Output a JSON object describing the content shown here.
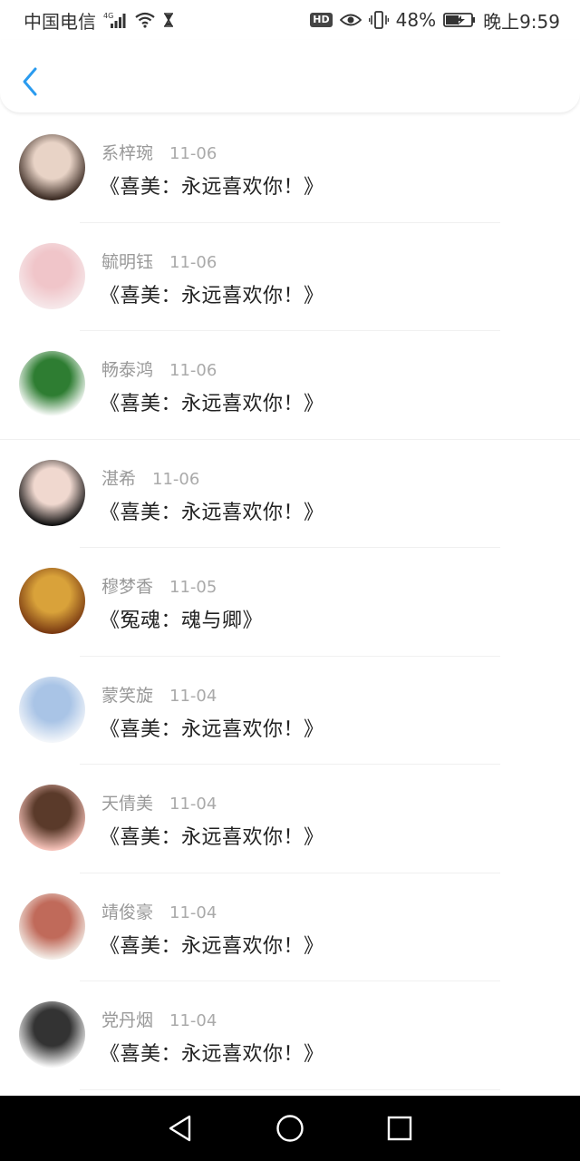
{
  "status_bar": {
    "carrier": "中国电信",
    "network": "4G",
    "hd": "HD",
    "battery": "48%",
    "time": "晚上9:59"
  },
  "accent_color": "#2a9bef",
  "items": [
    {
      "name": "系梓琬",
      "date": "11-06",
      "title": "《喜美：永远喜欢你！》",
      "avatar_colors": [
        "#3a2a22",
        "#e8d3c6"
      ]
    },
    {
      "name": "毓明钰",
      "date": "11-06",
      "title": "《喜美：永远喜欢你！》",
      "avatar_colors": [
        "#f6e8ea",
        "#f0c5c9"
      ]
    },
    {
      "name": "畅泰鸿",
      "date": "11-06",
      "title": "《喜美：永远喜欢你！》",
      "avatar_colors": [
        "#ffffff",
        "#2e7d32"
      ]
    },
    {
      "name": "湛希",
      "date": "11-06",
      "title": "《喜美：永远喜欢你！》",
      "avatar_colors": [
        "#111111",
        "#f0d8cf"
      ]
    },
    {
      "name": "穆梦香",
      "date": "11-05",
      "title": "《冤魂：魂与卿》",
      "avatar_colors": [
        "#7a3a12",
        "#d9a23a"
      ]
    },
    {
      "name": "蒙笑旋",
      "date": "11-04",
      "title": "《喜美：永远喜欢你！》",
      "avatar_colors": [
        "#f3f6fa",
        "#a9c4e6"
      ]
    },
    {
      "name": "天倩美",
      "date": "11-04",
      "title": "《喜美：永远喜欢你！》",
      "avatar_colors": [
        "#f6c2b9",
        "#5a3a2a"
      ]
    },
    {
      "name": "靖俊豪",
      "date": "11-04",
      "title": "《喜美：永远喜欢你！》",
      "avatar_colors": [
        "#f3ece6",
        "#c06a5a"
      ]
    },
    {
      "name": "党丹烟",
      "date": "11-04",
      "title": "《喜美：永远喜欢你！》",
      "avatar_colors": [
        "#f4f4f4",
        "#333333"
      ]
    }
  ]
}
